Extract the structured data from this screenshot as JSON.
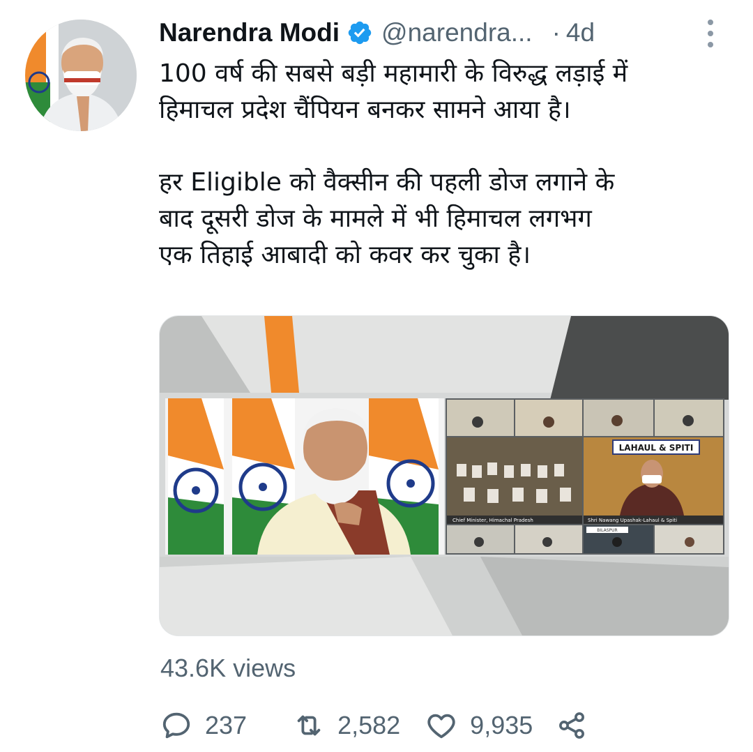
{
  "author": {
    "name": "Narendra Modi",
    "handle": "@narendra...",
    "separator": "·",
    "time": "4d",
    "avatar_icon": "profile-photo",
    "verified_icon": "verified-badge-icon"
  },
  "tweet": {
    "paragraph1_line1": "100 वर्ष की सबसे बड़ी महामारी के विरुद्ध लड़ाई में",
    "paragraph1_line2": "हिमाचल प्रदेश चैंपियन बनकर सामने आया है।",
    "paragraph2_line1": "हर Eligible को वैक्सीन की पहली डोज लगाने के",
    "paragraph2_line2": "बाद दूसरी डोज के मामले में भी हिमाचल लगभग",
    "paragraph2_line3": "एक तिहाई आबादी को कवर कर चुका है।"
  },
  "media": {
    "label_lahaul": "LAHAUL & SPITI",
    "caption_cm": "Chief Minister, Himachal Pradesh",
    "caption_nawang": "Shri Nawang Upashak-Lahaul & Spiti",
    "label_bilaspur": "BILASPUR"
  },
  "stats": {
    "views": "43.6K views",
    "replies": "237",
    "retweets": "2,582",
    "likes": "9,935"
  },
  "colors": {
    "text": "#0f1419",
    "secondary": "#536471",
    "verified": "#1d9bf0"
  }
}
